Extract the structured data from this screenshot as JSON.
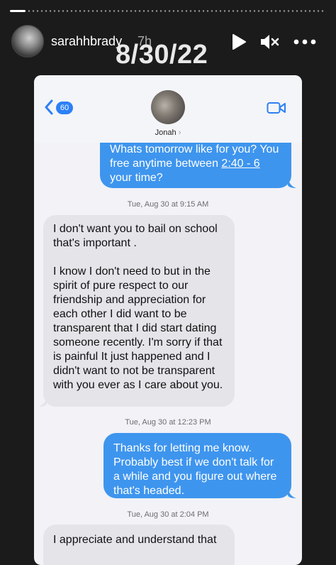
{
  "story": {
    "username": "sarahhbrady",
    "time_ago": "7h",
    "date_overlay": "8/30/22",
    "progress": 0.05,
    "icons": [
      "play-icon",
      "mute-icon",
      "more-icon"
    ]
  },
  "thread": {
    "back_badge": "60",
    "contact_name": "Jonah",
    "contact_chevron": "›",
    "messages": [
      {
        "direction": "outgoing",
        "pre": "Whats tomorrow like for you? You free anytime between ",
        "link": "2:40 - 6",
        "post": " your time?"
      },
      {
        "type": "timestamp",
        "text": "Tue, Aug 30 at 9:15 AM"
      },
      {
        "direction": "incoming",
        "text": "I don't want you to bail on school that's important .\n\nI know I don't need to but in the spirit of pure respect to our friendship and appreciation for each other I did want to be transparent that I did start dating someone recently. I'm sorry if that is painful It just happened and I didn't want to not be transparent with you ever as I care about you."
      },
      {
        "type": "timestamp",
        "text": "Tue, Aug 30 at 12:23 PM"
      },
      {
        "direction": "outgoing",
        "text": "Thanks for letting me know. Probably best if we don't talk for a while and you figure out where that's headed."
      },
      {
        "type": "timestamp",
        "text": "Tue, Aug 30 at 2:04 PM"
      },
      {
        "direction": "incoming",
        "text": "I appreciate and understand that"
      }
    ]
  },
  "colors": {
    "background": "#1b1b1b",
    "outgoing_bubble": "#3e95ee",
    "incoming_bubble": "#e4e4e9",
    "accent": "#2d80f6"
  }
}
